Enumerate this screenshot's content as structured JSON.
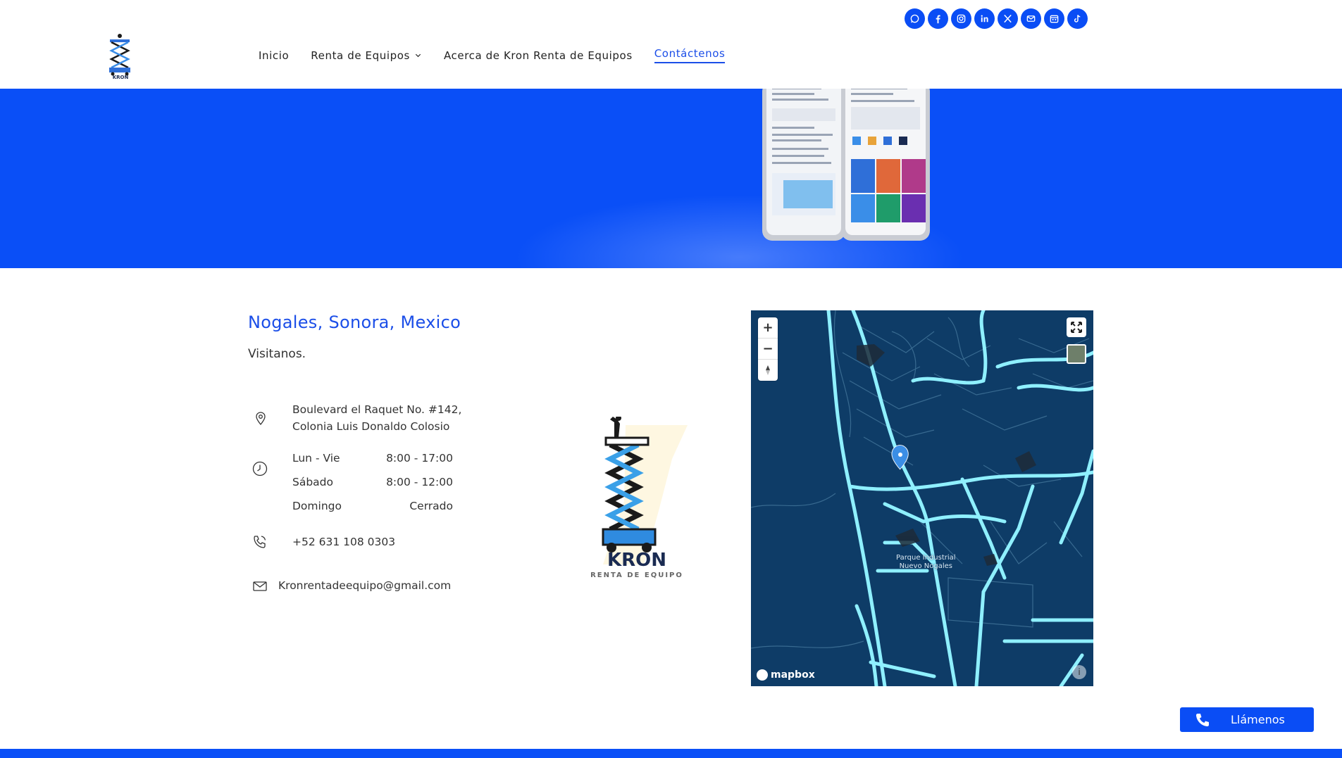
{
  "header": {
    "logo_text": "KRON",
    "logo_subtext": "RENTA DE EQUIPO",
    "nav": {
      "inicio": "Inicio",
      "renta": "Renta de Equipos",
      "acerca": "Acerca de Kron Renta de Equipos",
      "contacto": "Contáctenos"
    },
    "social_icons": [
      "whatsapp-icon",
      "facebook-icon",
      "instagram-icon",
      "linkedin-icon",
      "x-icon",
      "email-icon",
      "calendar-icon",
      "tiktok-icon"
    ]
  },
  "location": {
    "title": "Nogales, Sonora, Mexico",
    "subtitle": "Visitanos.",
    "address_line1": "Boulevard el Raquet No. #142,",
    "address_line2": "Colonia Luis Donaldo Colosio",
    "hours": [
      {
        "day": "Lun - Vie",
        "time": "8:00 - 17:00"
      },
      {
        "day": "Sábado",
        "time": "8:00 - 12:00"
      },
      {
        "day": "Domingo",
        "time": "Cerrado"
      }
    ],
    "phone": "+52 631 108 0303",
    "email": "Kronrentadeequipo@gmail.com"
  },
  "logo": {
    "name": "KRON",
    "tagline": "RENTA DE EQUIPO"
  },
  "map": {
    "brand": "mapbox",
    "place_label_1": "Parque Industrial",
    "place_label_2": "Nuevo Nogales",
    "zoom_in": "+",
    "zoom_out": "−"
  },
  "call_button": {
    "label": "Llámenos"
  },
  "colors": {
    "brand_blue": "#0a4ff7",
    "link_blue": "#1b4ee8",
    "map_bg": "#0e3c67",
    "road": "#8ff0ff"
  }
}
